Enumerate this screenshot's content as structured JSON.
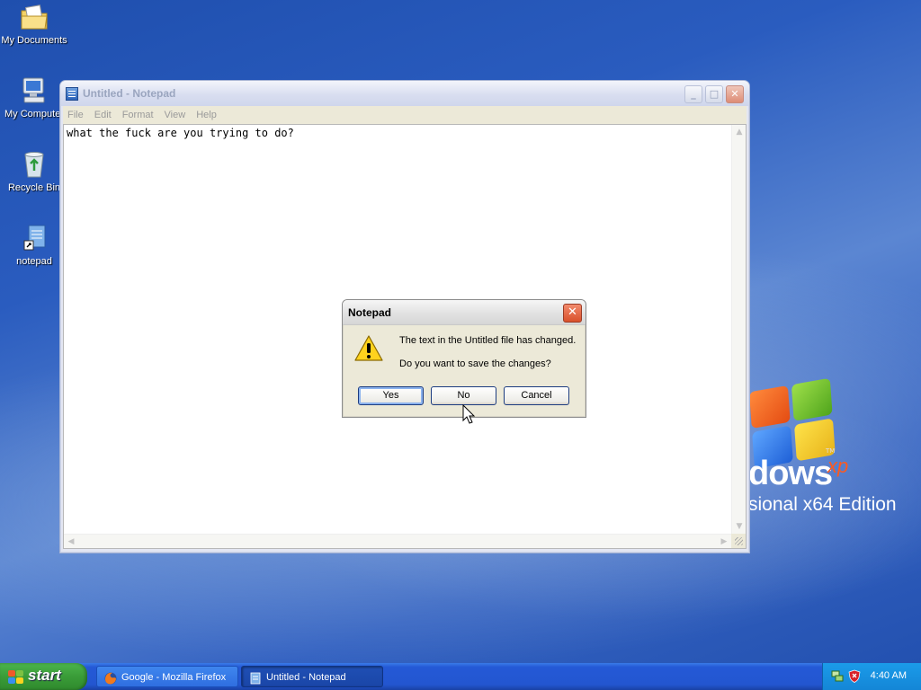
{
  "desktop": {
    "icons": [
      {
        "label": "My Documents",
        "icon": "folder-documents-icon"
      },
      {
        "label": "My Computer",
        "icon": "computer-icon"
      },
      {
        "label": "Recycle Bin",
        "icon": "recycle-bin-icon"
      },
      {
        "label": "notepad",
        "icon": "notepad-shortcut-icon"
      }
    ],
    "wallpaper": {
      "logo_text": "dows",
      "logo_superscript": "xp",
      "logo_tm": "TM",
      "edition": "sional x64 Edition"
    }
  },
  "notepad": {
    "title": "Untitled - Notepad",
    "menu": [
      "File",
      "Edit",
      "Format",
      "View",
      "Help"
    ],
    "content": "what the fuck are you trying to do?",
    "state": "inactive"
  },
  "dialog": {
    "title": "Notepad",
    "close_label": "✕",
    "message_line1": "The text in the Untitled file has changed.",
    "message_line2": "Do you want to save the changes?",
    "buttons": {
      "yes": "Yes",
      "no": "No",
      "cancel": "Cancel"
    },
    "icon": "warning-icon"
  },
  "taskbar": {
    "start_label": "start",
    "tasks": [
      {
        "label": "Google - Mozilla Firefox",
        "icon": "firefox-icon",
        "active": false
      },
      {
        "label": "Untitled - Notepad",
        "icon": "notepad-icon",
        "active": true
      }
    ],
    "clock": "4:40 AM"
  },
  "colors": {
    "taskbar_blue": "#2459d6",
    "start_green": "#3a9c38",
    "tray_blue": "#1486d6",
    "dialog_bg": "#ece9d8"
  }
}
